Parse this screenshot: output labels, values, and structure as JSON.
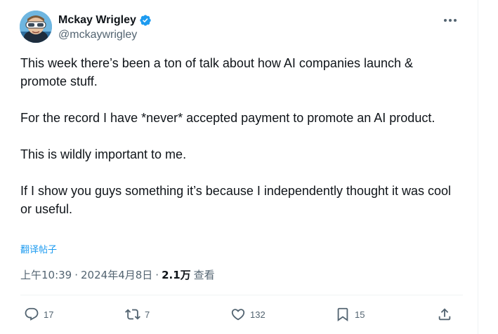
{
  "author": {
    "display_name": "Mckay Wrigley",
    "handle": "@mckaywrigley",
    "verified": true
  },
  "tweet": {
    "paragraphs": [
      "This week there’s been a ton of talk about how AI companies launch & promote stuff.",
      "For the record I have *never* accepted payment to promote an AI product.",
      "This is wildly important to me.",
      "If I show you guys something it’s because I independently thought it was cool or useful."
    ],
    "translate_label": "翻译帖子",
    "time": "上午10:39",
    "date": "2024年4月8日",
    "separator": "·",
    "views": "2.1万",
    "views_label": "查看"
  },
  "actions": {
    "replies": "17",
    "retweets": "7",
    "likes": "132",
    "bookmarks": "15"
  },
  "icons": {
    "more": "more-horizontal-icon",
    "verified": "verified-badge-icon",
    "reply": "reply-icon",
    "retweet": "retweet-icon",
    "like": "heart-icon",
    "bookmark": "bookmark-icon",
    "share": "share-icon"
  },
  "colors": {
    "accent": "#1d9bf0",
    "text": "#0f1419",
    "secondary": "#536471",
    "border": "#eff3f4"
  }
}
